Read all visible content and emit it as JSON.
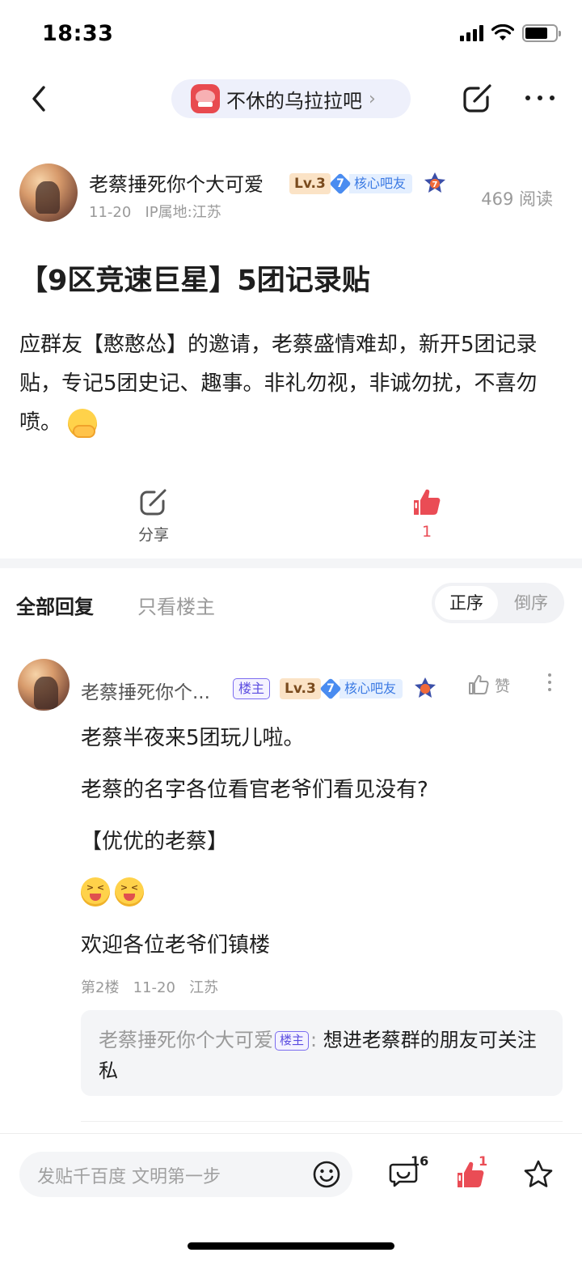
{
  "status_bar": {
    "time": "18:33"
  },
  "nav": {
    "forum_name": "不休的乌拉拉吧",
    "chevron": "›"
  },
  "post": {
    "author": "老蔡捶死你个大可爱",
    "level": "Lv.3",
    "core_badge_num": "7",
    "core_badge_text": "核心吧友",
    "medal_num": "7",
    "date": "11-20",
    "ip": "IP属地:江苏",
    "read_count": "469 阅读",
    "title": "【9区竞速巨星】5团记录贴",
    "body": "应群友【憨憨怂】的邀请，老蔡盛情难却，新开5团记录贴，专记5团史记、趣事。非礼勿视，非诚勿扰，不喜勿喷。",
    "share_label": "分享",
    "like_count": "1"
  },
  "tabs": {
    "all": "全部回复",
    "op_only": "只看楼主",
    "sort_asc": "正序",
    "sort_desc": "倒序"
  },
  "reply": {
    "author": "老蔡捶死你个...",
    "lz_badge": "楼主",
    "level": "Lv.3",
    "core_badge_num": "7",
    "core_badge_text": "核心吧友",
    "like_label": "赞",
    "lines": [
      "老蔡半夜来5团玩儿啦。",
      "老蔡的名字各位看官老爷们看见没有?",
      "【优优的老蔡】",
      "欢迎各位老爷们镇楼"
    ],
    "floor": "第2楼",
    "date": "11-20",
    "location": "江苏",
    "sub_reply": {
      "author": "老蔡捶死你个大可爱",
      "lz_badge": "楼主",
      "colon": ":",
      "text": "想进老蔡群的朋友可关注私"
    }
  },
  "bottom_bar": {
    "placeholder": "发贴千百度 文明第一步",
    "comment_count": "16",
    "like_count": "1"
  },
  "colors": {
    "accent_red": "#ea4c55",
    "link_blue": "#3b7ae3",
    "lz_purple": "#5b4de0"
  }
}
